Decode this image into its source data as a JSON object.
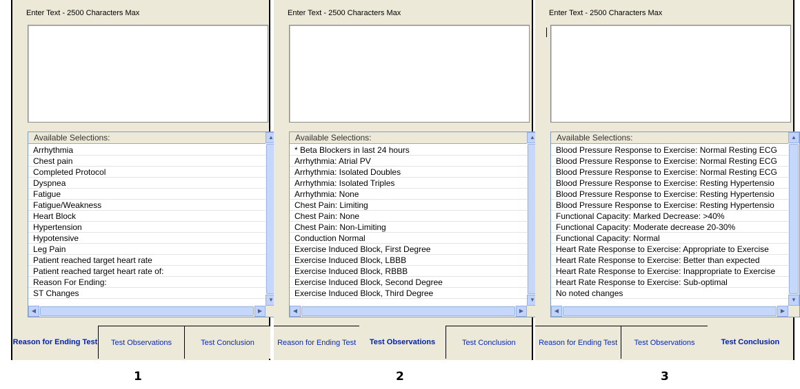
{
  "panels": [
    {
      "title": "Enter Text - 2500 Characters Max",
      "list_header": "Available Selections:",
      "items": [
        "Arrhythmia",
        "Chest pain",
        "Completed Protocol",
        "Dyspnea",
        "Fatigue",
        "Fatigue/Weakness",
        "Heart Block",
        "Hypertension",
        "Hypotensive",
        "Leg Pain",
        "Patient reached target heart rate",
        "Patient reached target heart rate of:",
        "Reason For Ending:",
        "ST Changes"
      ],
      "tabs": [
        "Reason for Ending Test",
        "Test Observations",
        "Test Conclusion"
      ],
      "active_tab": 0,
      "number": "1"
    },
    {
      "title": "Enter Text - 2500 Characters Max",
      "list_header": "Available Selections:",
      "items": [
        "* Beta Blockers in last 24 hours",
        "Arrhythmia: Atrial PV",
        "Arrhythmia: Isolated Doubles",
        "Arrhythmia: Isolated Triples",
        "Arrhythmia: None",
        "Chest Pain: Limiting",
        "Chest Pain: None",
        "Chest Pain: Non-Limiting",
        "Conduction Normal",
        "Exercise Induced Block, First Degree",
        "Exercise Induced Block, LBBB",
        "Exercise Induced Block, RBBB",
        "Exercise Induced Block, Second Degree",
        "Exercise Induced Block, Third Degree"
      ],
      "tabs": [
        "Reason for Ending Test",
        "Test Observations",
        "Test Conclusion"
      ],
      "active_tab": 1,
      "number": "2"
    },
    {
      "title": "Enter Text - 2500 Characters Max",
      "list_header": "Available Selections:",
      "items": [
        "Blood Pressure Response to Exercise: Normal Resting ECG",
        "Blood Pressure Response to Exercise: Normal Resting ECG",
        "Blood Pressure Response to Exercise: Normal Resting ECG",
        "Blood Pressure Response to Exercise: Resting Hypertensio",
        "Blood Pressure Response to Exercise: Resting Hypertensio",
        "Blood Pressure Response to Exercise: Resting Hypertensio",
        "Functional Capacity: Marked Decrease: >40%",
        "Functional Capacity: Moderate decrease 20-30%",
        "Functional Capacity: Normal",
        "Heart Rate Response to Exercise: Appropriate to Exercise",
        "Heart Rate Response to Exercise: Better than expected",
        "Heart Rate Response to Exercise: Inappropriate to Exercise",
        "Heart Rate Response to Exercise: Sub-optimal",
        "No noted changes"
      ],
      "tabs": [
        "Reason for Ending Test",
        "Test Observations",
        "Test Conclusion"
      ],
      "active_tab": 2,
      "number": "3"
    }
  ],
  "icons": {
    "scroll_up": "▲",
    "scroll_down": "▼",
    "scroll_left": "◀",
    "scroll_right": "▶"
  }
}
